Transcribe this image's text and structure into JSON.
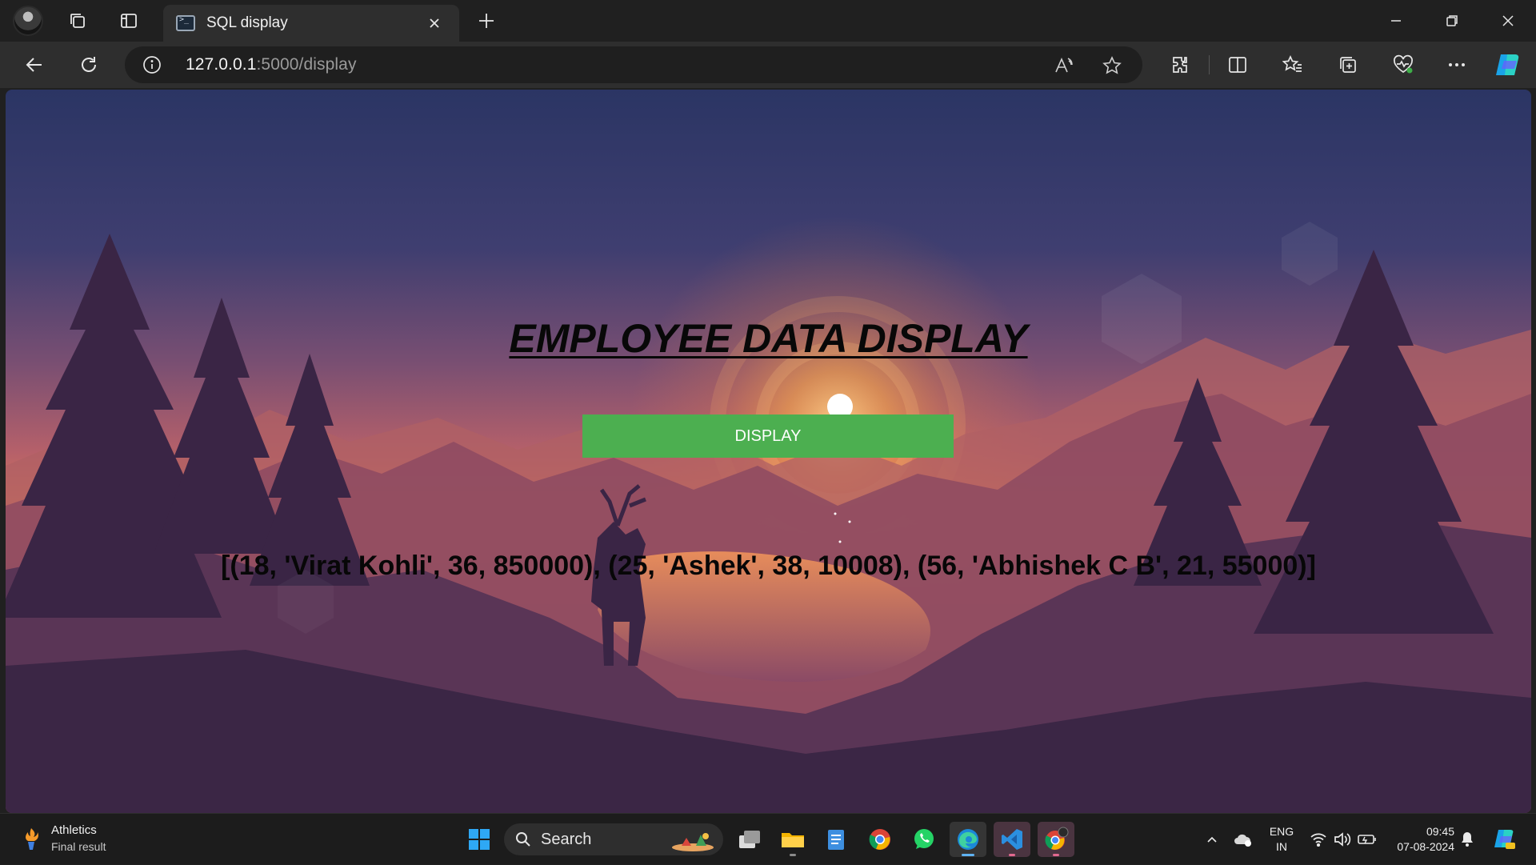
{
  "browser": {
    "tab_title": "SQL display",
    "url_host": "127.0.0.1",
    "url_rest": ":5000/display"
  },
  "page": {
    "title": "EMPLOYEE DATA DISPLAY",
    "display_button": "DISPLAY",
    "result": "[(18, 'Virat Kohli', 36, 850000), (25, 'Ashek', 38, 10008), (56, 'Abhishek C B', 21, 55000)]"
  },
  "taskbar": {
    "weather_title": "Athletics",
    "weather_sub": "Final result",
    "search_label": "Search",
    "lang_line1": "ENG",
    "lang_line2": "IN",
    "time": "09:45",
    "date": "07-08-2024"
  },
  "colors": {
    "button": "#4caf50",
    "sky_top": "#2c3566",
    "sky_mid": "#c96a4a",
    "sun_glow": "#f08a3c"
  }
}
